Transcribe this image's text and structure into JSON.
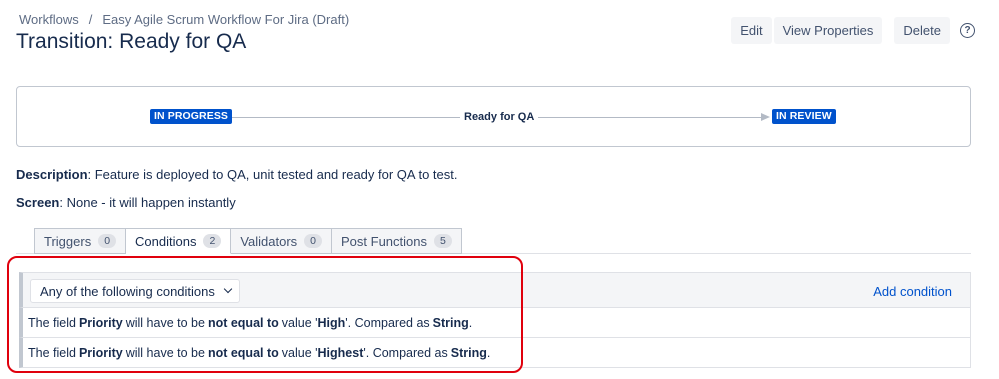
{
  "breadcrumb": {
    "root": "Workflows",
    "separator": "/",
    "workflow": "Easy Agile Scrum Workflow For Jira (Draft)"
  },
  "title": "Transition: Ready for QA",
  "actions": {
    "edit": "Edit",
    "view_properties": "View Properties",
    "delete": "Delete",
    "help_icon": "?"
  },
  "diagram": {
    "from_status": "IN PROGRESS",
    "transition": "Ready for QA",
    "to_status": "IN REVIEW"
  },
  "description": {
    "label": "Description",
    "text": ": Feature is deployed to QA, unit tested and ready for QA to test."
  },
  "screen": {
    "label": "Screen",
    "text": ": None - it will happen instantly"
  },
  "tabs": [
    {
      "label": "Triggers",
      "count": "0"
    },
    {
      "label": "Conditions",
      "count": "2"
    },
    {
      "label": "Validators",
      "count": "0"
    },
    {
      "label": "Post Functions",
      "count": "5"
    }
  ],
  "conditions": {
    "mode_select": "Any of the following conditions",
    "add_link": "Add condition",
    "rows": [
      {
        "p1": "The field",
        "field": "Priority",
        "p2": "will have to be",
        "op": "not equal to",
        "p3": "value '",
        "value": "High",
        "p4": "'. Compared as",
        "type": "String",
        "p5": "."
      },
      {
        "p1": "The field",
        "field": "Priority",
        "p2": "will have to be",
        "op": "not equal to",
        "p3": "value '",
        "value": "Highest",
        "p4": "'. Compared as",
        "type": "String",
        "p5": "."
      }
    ]
  },
  "colors": {
    "status_lozenge": "#0052cc",
    "link": "#0052cc",
    "highlight": "#e0000d"
  }
}
